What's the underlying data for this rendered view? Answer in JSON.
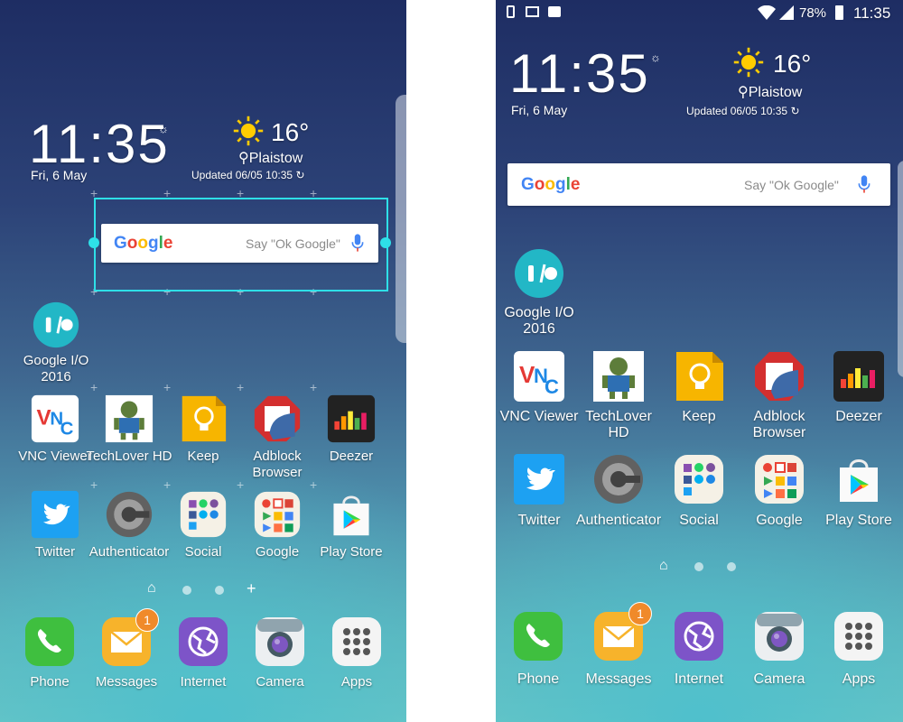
{
  "colors": {
    "selection": "#2ee0e8",
    "badge": "#f08a2a",
    "mic": "#4285f4"
  },
  "left": {
    "clock": {
      "time": "11:35",
      "date": "Fri, 6 May"
    },
    "weather": {
      "temp": "16°",
      "location": "Plaistow",
      "updated": "Updated 06/05 10:35"
    },
    "search": {
      "logo": "Google",
      "placeholder": "Say \"Ok Google\""
    },
    "folder": {
      "label": "Google I/O 2016"
    },
    "row1": [
      {
        "label": "VNC Viewer",
        "icon": "vnc-viewer-icon"
      },
      {
        "label": "TechLover HD",
        "icon": "techlover-icon"
      },
      {
        "label": "Keep",
        "icon": "keep-icon"
      },
      {
        "label": "Adblock Browser",
        "icon": "adblock-icon"
      },
      {
        "label": "Deezer",
        "icon": "deezer-icon"
      }
    ],
    "row2": [
      {
        "label": "Twitter",
        "icon": "twitter-icon"
      },
      {
        "label": "Authenticator",
        "icon": "authenticator-icon"
      },
      {
        "label": "Social",
        "icon": "social-folder-icon"
      },
      {
        "label": "Google",
        "icon": "google-folder-icon"
      },
      {
        "label": "Play Store",
        "icon": "play-store-icon"
      }
    ],
    "dock": [
      {
        "label": "Phone",
        "icon": "phone-icon"
      },
      {
        "label": "Messages",
        "icon": "messages-icon",
        "badge": "1"
      },
      {
        "label": "Internet",
        "icon": "internet-icon"
      },
      {
        "label": "Camera",
        "icon": "camera-icon"
      },
      {
        "label": "Apps",
        "icon": "apps-icon"
      }
    ]
  },
  "right": {
    "status": {
      "battery": "78%",
      "time": "11:35"
    },
    "clock": {
      "time": "11:35",
      "date": "Fri, 6 May"
    },
    "weather": {
      "temp": "16°",
      "location": "Plaistow",
      "updated": "Updated 06/05 10:35"
    },
    "search": {
      "logo": "Google",
      "placeholder": "Say \"Ok Google\""
    },
    "folder": {
      "label": "Google I/O 2016"
    },
    "row1": [
      {
        "label": "VNC Viewer"
      },
      {
        "label": "TechLover HD"
      },
      {
        "label": "Keep"
      },
      {
        "label": "Adblock Browser"
      },
      {
        "label": "Deezer"
      }
    ],
    "row2": [
      {
        "label": "Twitter"
      },
      {
        "label": "Authenticator"
      },
      {
        "label": "Social"
      },
      {
        "label": "Google"
      },
      {
        "label": "Play Store"
      }
    ],
    "dock": [
      {
        "label": "Phone"
      },
      {
        "label": "Messages",
        "badge": "1"
      },
      {
        "label": "Internet"
      },
      {
        "label": "Camera"
      },
      {
        "label": "Apps"
      }
    ]
  }
}
